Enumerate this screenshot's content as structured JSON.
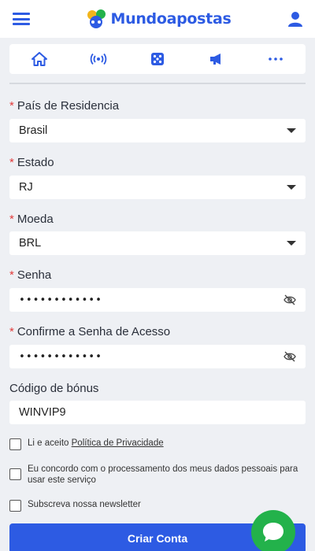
{
  "header": {
    "logo_text": "Mundoapostas",
    "brand_color": "#2d5be3"
  },
  "navbar": {
    "items": [
      {
        "icon": "home-icon"
      },
      {
        "icon": "live-broadcast-icon"
      },
      {
        "icon": "dice-icon"
      },
      {
        "icon": "megaphone-icon"
      },
      {
        "icon": "more-icon"
      }
    ]
  },
  "form": {
    "country": {
      "label": "País de Residencia",
      "value": "Brasil",
      "required": true
    },
    "state": {
      "label": "Estado",
      "value": "RJ",
      "required": true
    },
    "currency": {
      "label": "Moeda",
      "value": "BRL",
      "required": true
    },
    "password": {
      "label": "Senha",
      "value": "••••••••••••",
      "required": true
    },
    "confirm_password": {
      "label": "Confirme a Senha de Acesso",
      "value": "••••••••••••",
      "required": true
    },
    "bonus": {
      "label": "Código de bónus",
      "value": "WINVIP9"
    },
    "required_mark": "*",
    "privacy_prefix": "Li e aceito",
    "privacy_link": "Política de Privacidade",
    "data_processing": "Eu concordo com o processamento dos meus dados pessoais para usar este serviço",
    "newsletter": "Subscreva nossa newsletter",
    "submit_label": "Criar Conta"
  },
  "colors": {
    "accent": "#2d5be3",
    "required": "#e23b3b",
    "chat": "#23b24b"
  }
}
